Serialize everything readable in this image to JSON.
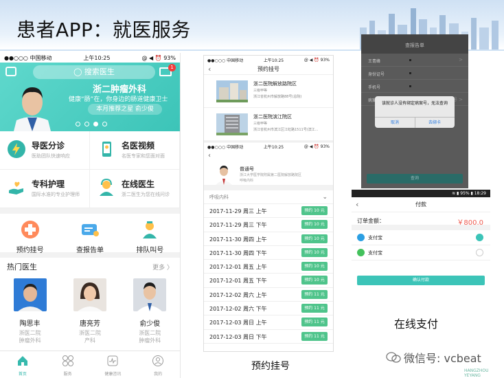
{
  "slide": {
    "title": "患者APP：就医服务",
    "caption_booking": "预约挂号",
    "caption_payment": "在线支付",
    "watermark": "微信号: vcbeat",
    "brand_corner": "HANGZHOU YEYANG"
  },
  "home": {
    "status": {
      "carrier": "●●○○○ 中国移动 ",
      "time": "上午10:25",
      "battery": "@ ◀ ⏰ 93%"
    },
    "search_placeholder": "搜索医生",
    "mail_badge": "1",
    "hero": {
      "dept": "浙二肿瘤外科",
      "slogan": "健康“肠”在，你身边的肠道健康卫士",
      "recommend": "本月推荐之星  俞少俊"
    },
    "services": [
      {
        "title": "导医分诊",
        "sub": "医助团队快速响应"
      },
      {
        "title": "名医视频",
        "sub": "名医专家和您面对面"
      },
      {
        "title": "专科护理",
        "sub": "国际水准的专业护理师"
      },
      {
        "title": "在线医生",
        "sub": "浙二医生为您在线问诊"
      }
    ],
    "quick": [
      {
        "label": "预约挂号"
      },
      {
        "label": "查报告单"
      },
      {
        "label": "排队叫号"
      }
    ],
    "hot_doctors": {
      "title": "热门医生",
      "more": "更多 〉"
    },
    "doctors": [
      {
        "name": "陶思丰",
        "hospital": "浙医二院",
        "dept": "肿瘤外科"
      },
      {
        "name": "唐亮芳",
        "hospital": "浙医二院",
        "dept": "产科"
      },
      {
        "name": "俞少俊",
        "hospital": "浙医二院",
        "dept": "肿瘤外科"
      }
    ],
    "tabs": [
      {
        "label": "首页"
      },
      {
        "label": "服务"
      },
      {
        "label": "健康咨讯"
      },
      {
        "label": "我的"
      }
    ]
  },
  "booking_hospitals": {
    "status": {
      "carrier": "●●○○○ 中国移动 ",
      "time": "上午10:25",
      "battery": "@ ◀ ⏰ 93%"
    },
    "nav_title": "预约挂号",
    "hospitals": [
      {
        "name": "浙二医院解放路院区",
        "level": "三级甲等",
        "address": "浙江省杭州市解放路88号(总院)"
      },
      {
        "name": "浙二医院滨江院区",
        "level": "三级甲等",
        "address": "浙江省杭州市滨江区江虹路1511号(滨江..."
      }
    ]
  },
  "booking_slots": {
    "status": {
      "carrier": "●●○○○ 中国移动 ",
      "time": "上午10:25",
      "battery": "@ ◀ ⏰ 93%"
    },
    "doctor": {
      "name": "普通号",
      "hospital": "浙江大学医学院附属第二医院解放路院区",
      "dept": "呼吸内科"
    },
    "select": "呼吸内科",
    "slots": [
      {
        "date": "2017-11-29 周三 上午",
        "btn": "预约 10 元"
      },
      {
        "date": "2017-11-29 周三 下午",
        "btn": "预约 10 元"
      },
      {
        "date": "2017-11-30 周四 上午",
        "btn": "预约 10 元"
      },
      {
        "date": "2017-11-30 周四 下午",
        "btn": "预约 10 元"
      },
      {
        "date": "2017-12-01 周五 上午",
        "btn": "预约 10 元"
      },
      {
        "date": "2017-12-01 周五 下午",
        "btn": "预约 10 元"
      },
      {
        "date": "2017-12-02 周六 上午",
        "btn": "预约 11 元"
      },
      {
        "date": "2017-12-02 周六 下午",
        "btn": "预约 11 元"
      },
      {
        "date": "2017-12-03 周日 上午",
        "btn": "预约 11 元"
      },
      {
        "date": "2017-12-03 周日 下午",
        "btn": "预约 11 元"
      }
    ]
  },
  "report": {
    "nav_title": "查报告单",
    "fields": [
      {
        "label": "王青峰",
        "arrow": ">"
      },
      {
        "label": "身份证号",
        "arrow": ""
      },
      {
        "label": "手机号",
        "arrow": ""
      },
      {
        "label": "病案号",
        "arrow": "暂无绑定病案号 >"
      }
    ],
    "dialog_msg": "该就诊人没有绑定病案号，无法查询",
    "cancel": "取消",
    "bind": "去绑卡",
    "query_btn": "查询"
  },
  "payment": {
    "status": "≋ ▮ 95% ▮ 18:29",
    "nav_title": "付款",
    "order_label": "订单金额：",
    "order_value": "￥800.0",
    "methods": [
      {
        "label": "支付宝",
        "color": "#2b9fe3",
        "selected": true
      },
      {
        "label": "支付宝",
        "color": "#43c15c",
        "selected": false
      }
    ],
    "confirm": "确认付款"
  }
}
